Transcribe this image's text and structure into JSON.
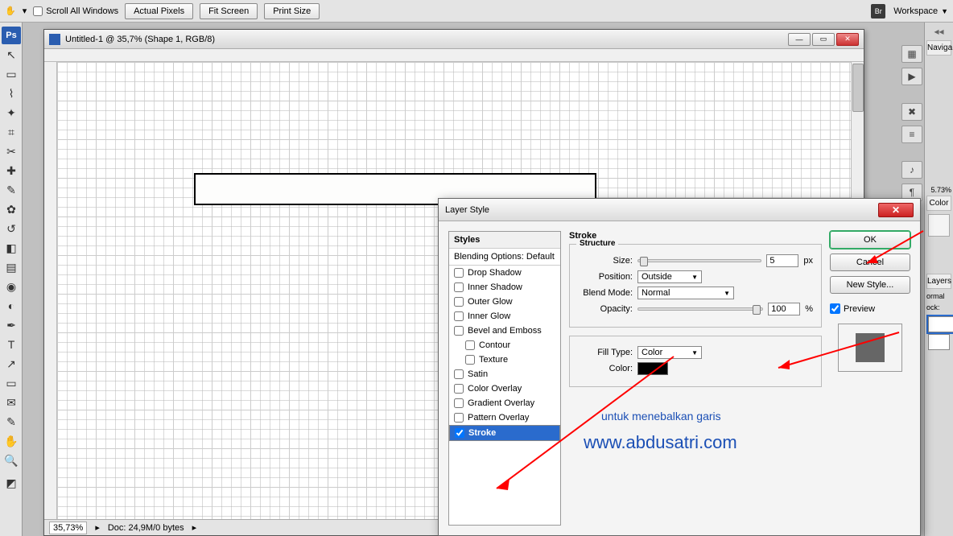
{
  "topbar": {
    "scroll_all": "Scroll All Windows",
    "actual_pixels": "Actual Pixels",
    "fit_screen": "Fit Screen",
    "print_size": "Print Size",
    "workspace": "Workspace",
    "br": "Br"
  },
  "doc": {
    "title": "Untitled-1 @ 35,7% (Shape 1, RGB/8)",
    "zoom": "35,73%",
    "docsize": "Doc: 24,9M/0 bytes"
  },
  "panels": {
    "nav": "Naviga",
    "color": "Color ",
    "layers": "Layers ",
    "normal": "ormal",
    "lock": "ock:",
    "pct": "5.73%"
  },
  "dialog": {
    "title": "Layer Style",
    "styles_header": "Styles",
    "blending": "Blending Options: Default",
    "opts": {
      "drop_shadow": "Drop Shadow",
      "inner_shadow": "Inner Shadow",
      "outer_glow": "Outer Glow",
      "inner_glow": "Inner Glow",
      "bevel": "Bevel and Emboss",
      "contour": "Contour",
      "texture": "Texture",
      "satin": "Satin",
      "color_overlay": "Color Overlay",
      "gradient_overlay": "Gradient Overlay",
      "pattern_overlay": "Pattern Overlay",
      "stroke": "Stroke"
    },
    "panel": {
      "title": "Stroke",
      "structure": "Structure",
      "size_lbl": "Size:",
      "size_val": "5",
      "size_unit": "px",
      "position_lbl": "Position:",
      "position_val": "Outside",
      "blend_lbl": "Blend Mode:",
      "blend_val": "Normal",
      "opacity_lbl": "Opacity:",
      "opacity_val": "100",
      "opacity_unit": "%",
      "filltype_lbl": "Fill Type:",
      "filltype_val": "Color",
      "color_lbl": "Color:"
    },
    "btns": {
      "ok": "OK",
      "cancel": "Cancel",
      "newstyle": "New Style...",
      "preview": "Preview"
    },
    "annot": "untuk menebalkan garis",
    "url": "www.abdusatri.com"
  }
}
